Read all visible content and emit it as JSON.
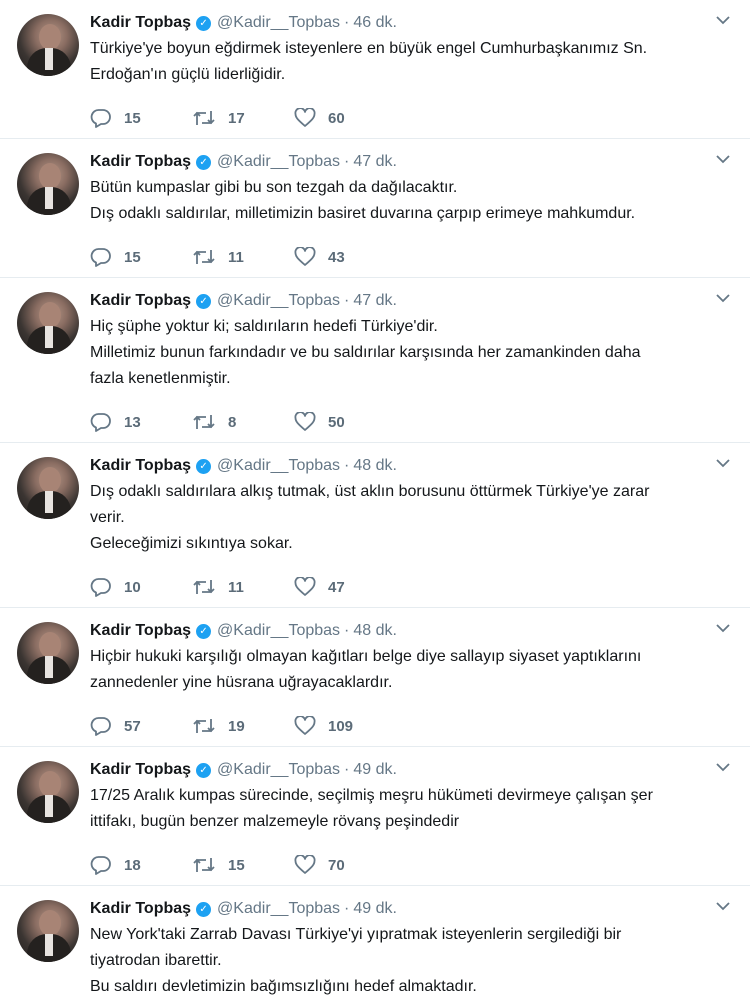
{
  "tweets": [
    {
      "name": "Kadir Topbaş",
      "handle": "@Kadir__Topbas",
      "time": "46 dk.",
      "lines": [
        "Türkiye'ye boyun eğdirmek isteyenlere en büyük engel Cumhurbaşkanımız Sn.",
        "Erdoğan'ın güçlü liderliğidir."
      ],
      "replies": "15",
      "retweets": "17",
      "likes": "60"
    },
    {
      "name": "Kadir Topbaş",
      "handle": "@Kadir__Topbas",
      "time": "47 dk.",
      "lines": [
        "Bütün kumpaslar gibi bu son tezgah da dağılacaktır.",
        "Dış odaklı saldırılar, milletimizin basiret duvarına çarpıp erimeye mahkumdur."
      ],
      "replies": "15",
      "retweets": "11",
      "likes": "43"
    },
    {
      "name": "Kadir Topbaş",
      "handle": "@Kadir__Topbas",
      "time": "47 dk.",
      "lines": [
        "Hiç şüphe yoktur ki; saldırıların hedefi Türkiye'dir.",
        "Milletimiz bunun farkındadır ve bu saldırılar karşısında her zamankinden daha",
        "fazla kenetlenmiştir."
      ],
      "replies": "13",
      "retweets": "8",
      "likes": "50"
    },
    {
      "name": "Kadir Topbaş",
      "handle": "@Kadir__Topbas",
      "time": "48 dk.",
      "lines": [
        "Dış odaklı saldırılara alkış tutmak, üst aklın borusunu öttürmek Türkiye'ye zarar",
        "verir.",
        "Geleceğimizi sıkıntıya sokar."
      ],
      "replies": "10",
      "retweets": "11",
      "likes": "47"
    },
    {
      "name": "Kadir Topbaş",
      "handle": "@Kadir__Topbas",
      "time": "48 dk.",
      "lines": [
        "Hiçbir hukuki karşılığı olmayan kağıtları belge diye sallayıp siyaset yaptıklarını",
        "zannedenler yine hüsrana uğrayacaklardır."
      ],
      "replies": "57",
      "retweets": "19",
      "likes": "109"
    },
    {
      "name": "Kadir Topbaş",
      "handle": "@Kadir__Topbas",
      "time": "49 dk.",
      "lines": [
        "17/25 Aralık kumpas sürecinde, seçilmiş meşru hükümeti devirmeye çalışan  şer",
        "ittifakı, bugün benzer malzemeyle rövanş peşindedir"
      ],
      "replies": "18",
      "retweets": "15",
      "likes": "70"
    },
    {
      "name": "Kadir Topbaş",
      "handle": "@Kadir__Topbas",
      "time": "49 dk.",
      "lines": [
        "New York'taki Zarrab Davası Türkiye'yi yıpratmak isteyenlerin sergilediği bir",
        "tiyatrodan ibarettir.",
        "Bu saldırı devletimizin bağımsızlığını hedef almaktadır."
      ],
      "replies": "",
      "retweets": "",
      "likes": ""
    }
  ],
  "icons": {
    "verified": "verified-badge-icon",
    "reply": "reply-icon",
    "retweet": "retweet-icon",
    "like": "heart-icon",
    "more": "chevron-down-icon"
  },
  "colors": {
    "verified": "#1da1f2",
    "muted": "#657786",
    "divider": "#e6ecf0"
  }
}
